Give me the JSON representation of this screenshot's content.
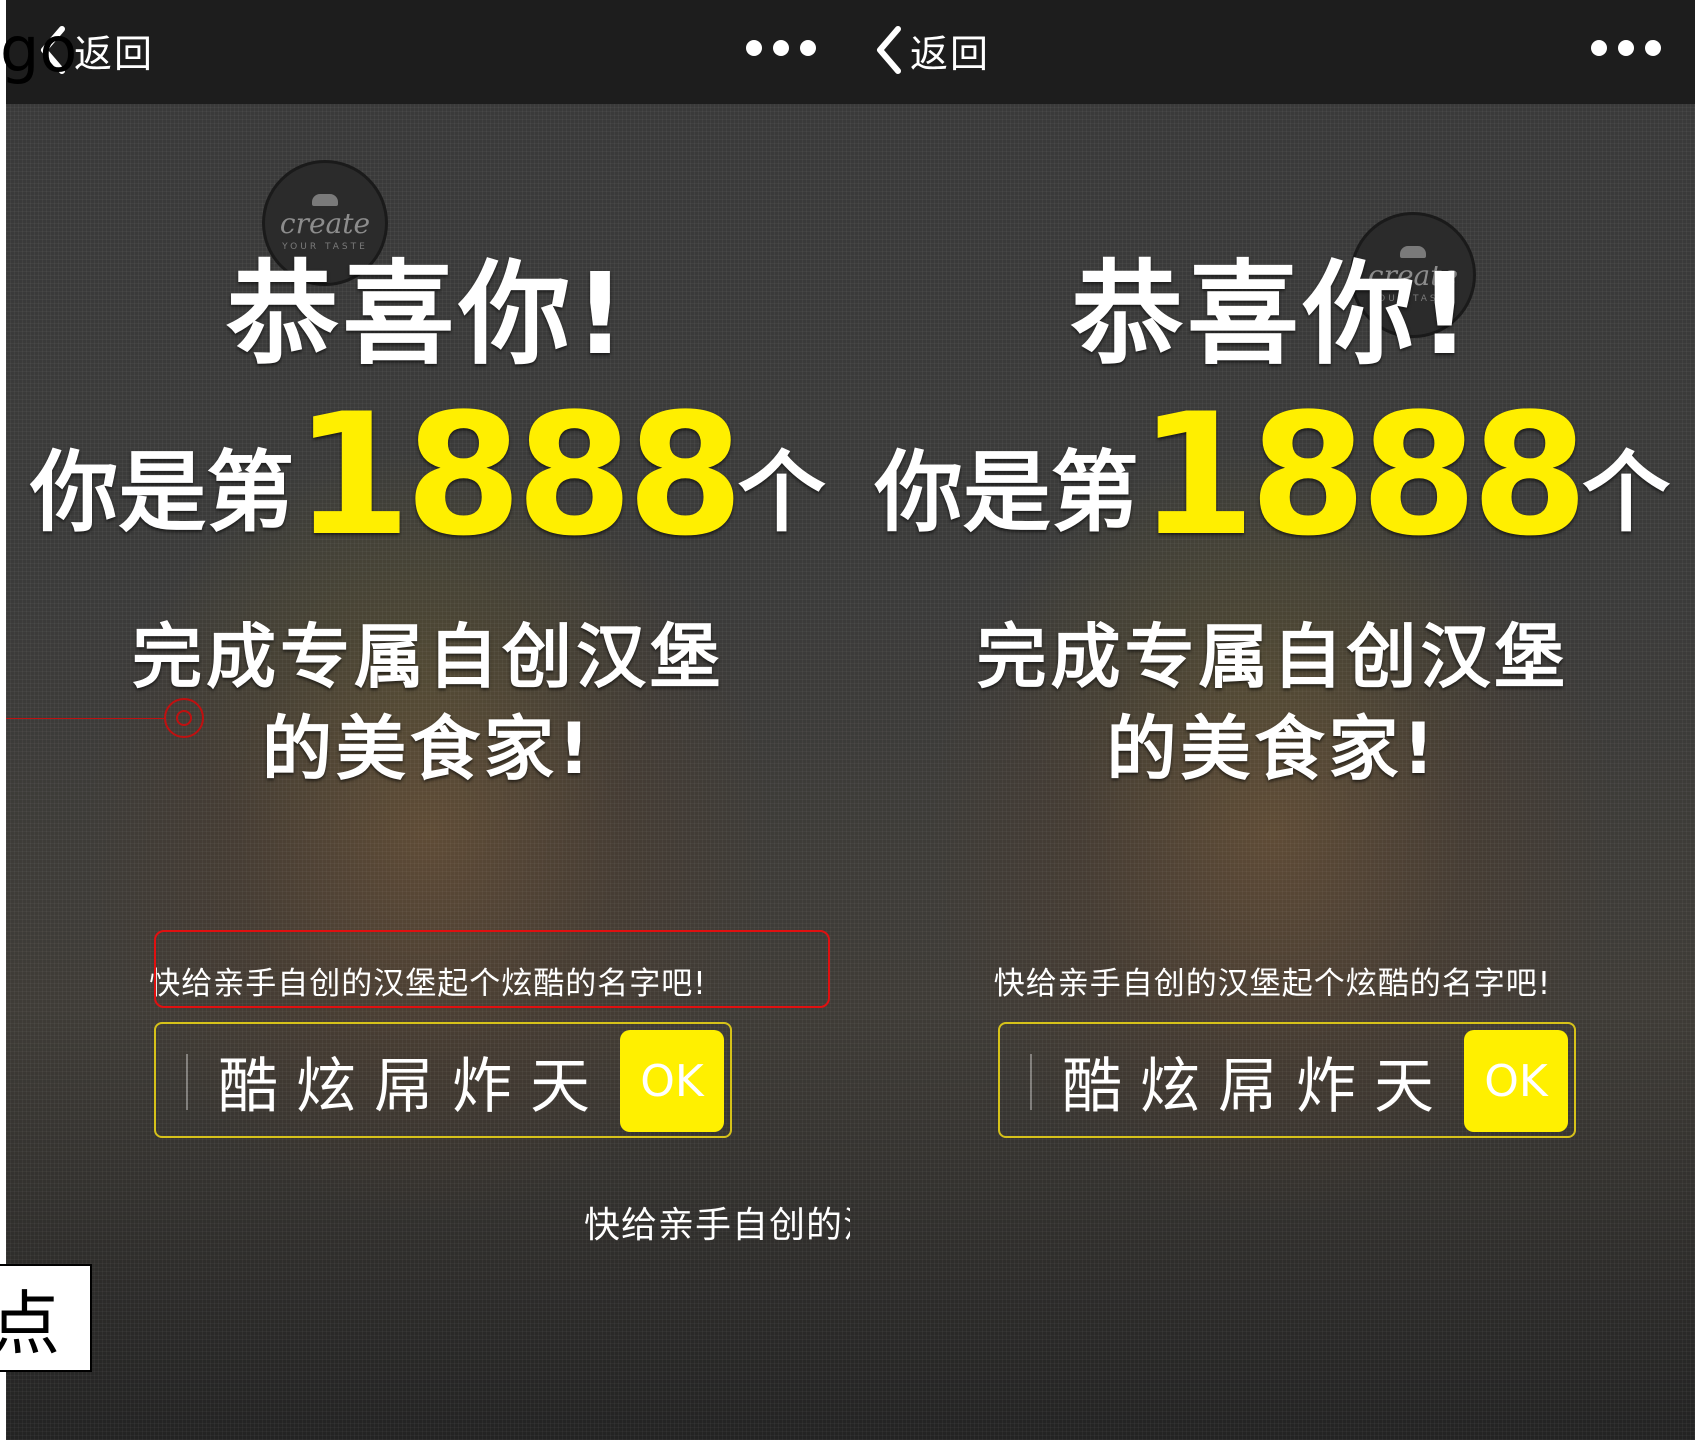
{
  "panels": [
    {
      "nav": {
        "back_label": "返回"
      },
      "logo": {
        "word": "create",
        "sub": "YOUR TASTE"
      },
      "headline": {
        "congrats": "恭喜你!",
        "rank_prefix": "你是第",
        "rank_number": "1888",
        "rank_suffix": "个",
        "line3": "完成专属自创汉堡",
        "line4": "的美食家!"
      },
      "hint": "快给亲手自创的汉堡起个炫酷的名字吧!",
      "name_input": {
        "value": "酷炫屌炸天"
      },
      "ok_label": "OK",
      "floating_text": "快给亲手自创的汉"
    },
    {
      "nav": {
        "back_label": "返回"
      },
      "logo": {
        "word": "create",
        "sub": "YOUR TASTE"
      },
      "headline": {
        "congrats": "恭喜你!",
        "rank_prefix": "你是第",
        "rank_number": "1888",
        "rank_suffix": "个",
        "line3": "完成专属自创汉堡",
        "line4": "的美食家!"
      },
      "hint": "快给亲手自创的汉堡起个炫酷的名字吧!",
      "name_input": {
        "value": "酷炫屌炸天"
      },
      "ok_label": "OK"
    }
  ],
  "overlay": {
    "corner_text": "go",
    "label_box_text": "点"
  },
  "colors": {
    "accent_yellow": "#fff000",
    "highlight_number": "#ffef00",
    "annotation_red": "#e01010",
    "topbar": "#1d1d1d"
  }
}
